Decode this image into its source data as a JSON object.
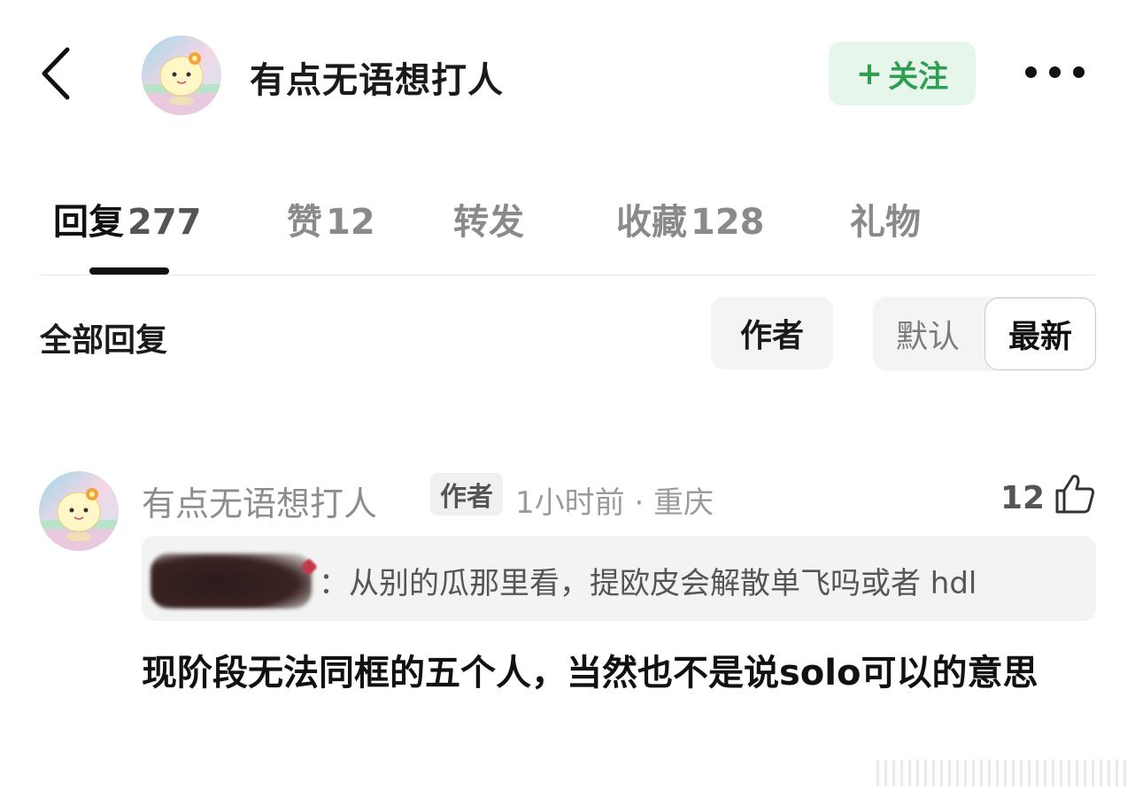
{
  "header": {
    "username": "有点无语想打人",
    "follow_plus": "+",
    "follow_label": "关注"
  },
  "tabs": [
    {
      "label": "回复",
      "count": "277"
    },
    {
      "label": "赞",
      "count": "12"
    },
    {
      "label": "转发",
      "count": ""
    },
    {
      "label": "收藏",
      "count": "128"
    },
    {
      "label": "礼物",
      "count": ""
    }
  ],
  "filter": {
    "title": "全部回复",
    "author_label": "作者",
    "sort_default": "默认",
    "sort_latest": "最新"
  },
  "comment": {
    "username": "有点无语想打人",
    "badge": "作者",
    "meta": "1小时前 · 重庆",
    "likes": "12",
    "quote": "：从别的瓜那里看，提欧皮会解散单飞吗或者 hdl",
    "body": "现阶段无法同框的五个人，当然也不是说solo可以的意思"
  },
  "colors": {
    "follow_bg": "#e6f6ea",
    "follow_text": "#2f9e52",
    "muted_text": "#8d8d8d",
    "panel_bg": "#f3f3f3"
  },
  "icons": [
    "back-chevron-icon",
    "more-dots-icon",
    "thumbs-up-icon"
  ]
}
